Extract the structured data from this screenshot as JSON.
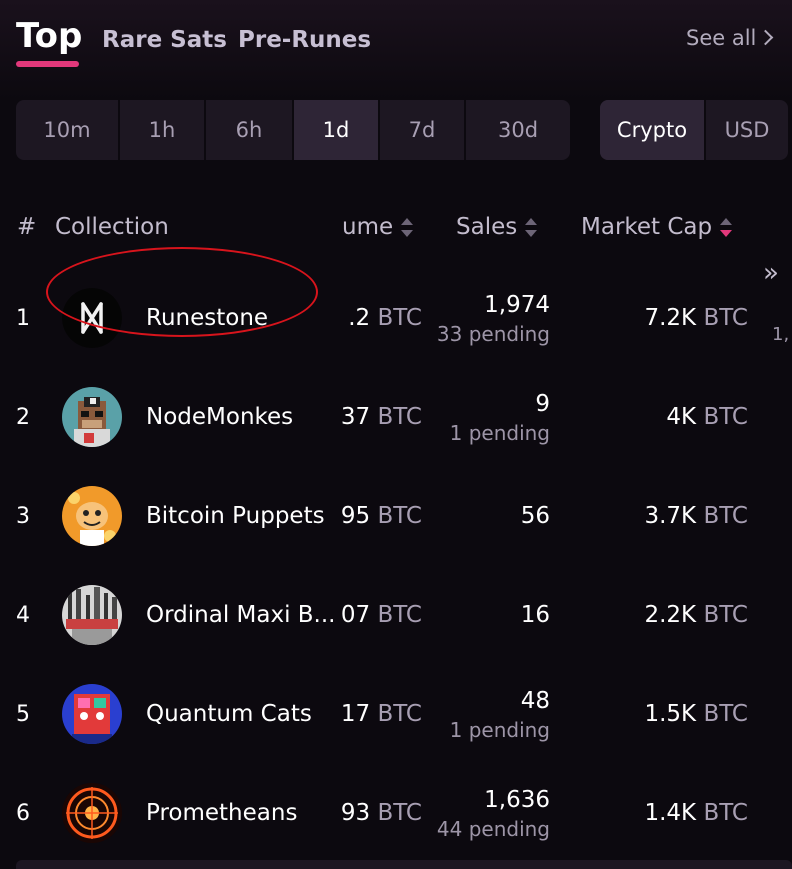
{
  "tabs": {
    "top": "Top",
    "rare_sats": "Rare Sats",
    "pre_runes": "Pre-Runes",
    "see_all": "See all"
  },
  "time_filters": [
    "10m",
    "1h",
    "6h",
    "1d",
    "7d",
    "30d"
  ],
  "active_time_filter": "1d",
  "currency_toggle": [
    "Crypto",
    "USD"
  ],
  "active_currency": "Crypto",
  "headers": {
    "rank": "#",
    "collection": "Collection",
    "volume": "ume",
    "sales": "Sales",
    "market_cap": "Market Cap"
  },
  "expand_icon": "»",
  "accent_color": "#e2387b",
  "rows": [
    {
      "rank": "1",
      "name": "Runestone",
      "volume": ".2",
      "unit": "BTC",
      "sales": "1,974",
      "pending": "33 pending",
      "market_cap": "7.2K",
      "edge": "1,",
      "icon": "runestone-logo"
    },
    {
      "rank": "2",
      "name": "NodeMonkes",
      "volume": "37",
      "unit": "BTC",
      "sales": "9",
      "pending": "1 pending",
      "market_cap": "4K",
      "edge": "",
      "icon": "nodemonkes-logo"
    },
    {
      "rank": "3",
      "name": "Bitcoin Puppets",
      "volume": "95",
      "unit": "BTC",
      "sales": "56",
      "pending": "",
      "market_cap": "3.7K",
      "edge": "",
      "icon": "bitcoin-puppets-logo"
    },
    {
      "rank": "4",
      "name": "Ordinal Maxi B...",
      "volume": "07",
      "unit": "BTC",
      "sales": "16",
      "pending": "",
      "market_cap": "2.2K",
      "edge": "",
      "icon": "ordinal-maxi-logo"
    },
    {
      "rank": "5",
      "name": "Quantum Cats",
      "volume": "17",
      "unit": "BTC",
      "sales": "48",
      "pending": "1 pending",
      "market_cap": "1.5K",
      "edge": "",
      "icon": "quantum-cats-logo"
    },
    {
      "rank": "6",
      "name": "Prometheans",
      "volume": "93",
      "unit": "BTC",
      "sales": "1,636",
      "pending": "44 pending",
      "market_cap": "1.4K",
      "edge": "",
      "icon": "prometheans-logo"
    }
  ]
}
